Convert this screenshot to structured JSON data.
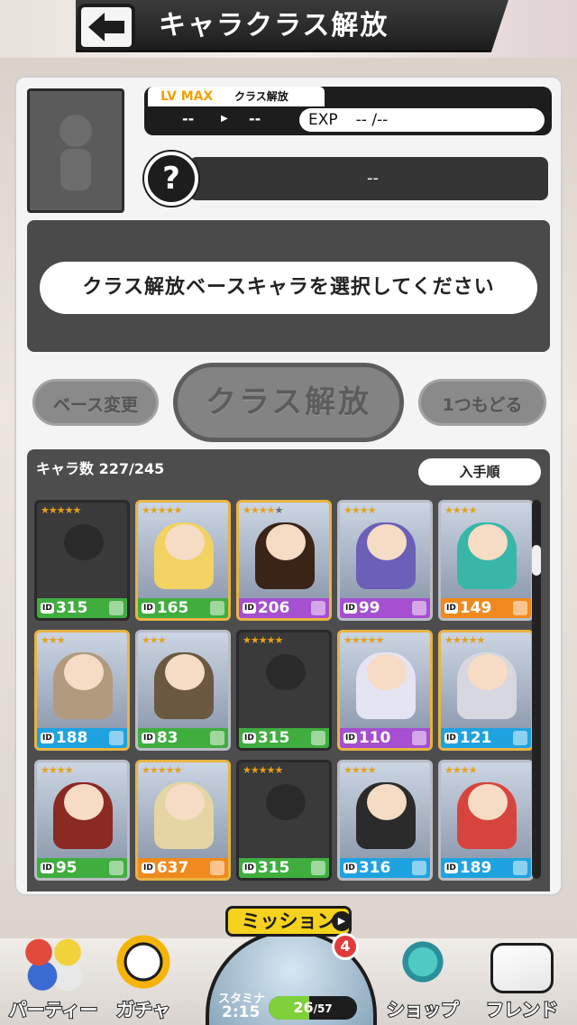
{
  "header": {
    "title": "キャラクラス解放",
    "back_icon": "back-arrow-icon"
  },
  "status": {
    "lv_max_label": "LV MAX",
    "class_tab_label": "クラス解放",
    "lv_from": "--",
    "lv_to": "--",
    "exp_label": "EXP",
    "exp_value": "-- /--",
    "class_value": "--",
    "question_mark": "?"
  },
  "message": "クラス解放ベースキャラを選択してください",
  "buttons": {
    "base_change": "ベース変更",
    "class_release": "クラス解放",
    "undo": "1つもどる"
  },
  "list": {
    "count_label": "キャラ数",
    "count_value": "227/245",
    "sort_label": "入手順",
    "cards": [
      {
        "id": "315",
        "stars": 5,
        "filled": 5,
        "color": "#3fae3f",
        "style": "dark",
        "art": "#3a3a3a"
      },
      {
        "id": "165",
        "stars": 5,
        "filled": 5,
        "color": "#3fae3f",
        "style": "gold",
        "art": "#f2d261"
      },
      {
        "id": "206",
        "stars": 5,
        "filled": 4,
        "color": "#a64fd1",
        "style": "gold",
        "art": "#3a2418"
      },
      {
        "id": "99",
        "stars": 4,
        "filled": 4,
        "color": "#a64fd1",
        "style": "silver",
        "art": "#6b5fb8"
      },
      {
        "id": "149",
        "stars": 4,
        "filled": 4,
        "color": "#f08a1e",
        "style": "silver",
        "art": "#38b7a8"
      },
      {
        "id": "188",
        "stars": 3,
        "filled": 3,
        "color": "#1fa3e0",
        "style": "gold",
        "art": "#b29a7f"
      },
      {
        "id": "83",
        "stars": 3,
        "filled": 3,
        "color": "#3fae3f",
        "style": "silver",
        "art": "#6b5840"
      },
      {
        "id": "315",
        "stars": 5,
        "filled": 5,
        "color": "#3fae3f",
        "style": "dark",
        "art": "#3a3a3a"
      },
      {
        "id": "110",
        "stars": 5,
        "filled": 5,
        "color": "#a64fd1",
        "style": "gold",
        "art": "#e4e4f2"
      },
      {
        "id": "121",
        "stars": 5,
        "filled": 5,
        "color": "#1fa3e0",
        "style": "gold",
        "art": "#d7d7df"
      },
      {
        "id": "95",
        "stars": 4,
        "filled": 4,
        "color": "#3fae3f",
        "style": "silver",
        "art": "#8a2a22"
      },
      {
        "id": "637",
        "stars": 5,
        "filled": 5,
        "color": "#f08a1e",
        "style": "gold",
        "art": "#e5d4a4"
      },
      {
        "id": "315",
        "stars": 5,
        "filled": 5,
        "color": "#3fae3f",
        "style": "dark",
        "art": "#3a3a3a"
      },
      {
        "id": "316",
        "stars": 4,
        "filled": 4,
        "color": "#1fa3e0",
        "style": "silver",
        "art": "#2b2b2b"
      },
      {
        "id": "189",
        "stars": 4,
        "filled": 4,
        "color": "#1fa3e0",
        "style": "silver",
        "art": "#d7443e"
      }
    ]
  },
  "nav": {
    "party": "パーティー",
    "gacha": "ガチャ",
    "mission": "ミッション",
    "mission_badge": "4",
    "stamina_label": "スタミナ",
    "stamina_time": "2:15",
    "stamina_current": "26",
    "stamina_max": "/57",
    "stamina_fraction": 0.456,
    "shop": "ショップ",
    "friend": "フレンド"
  }
}
